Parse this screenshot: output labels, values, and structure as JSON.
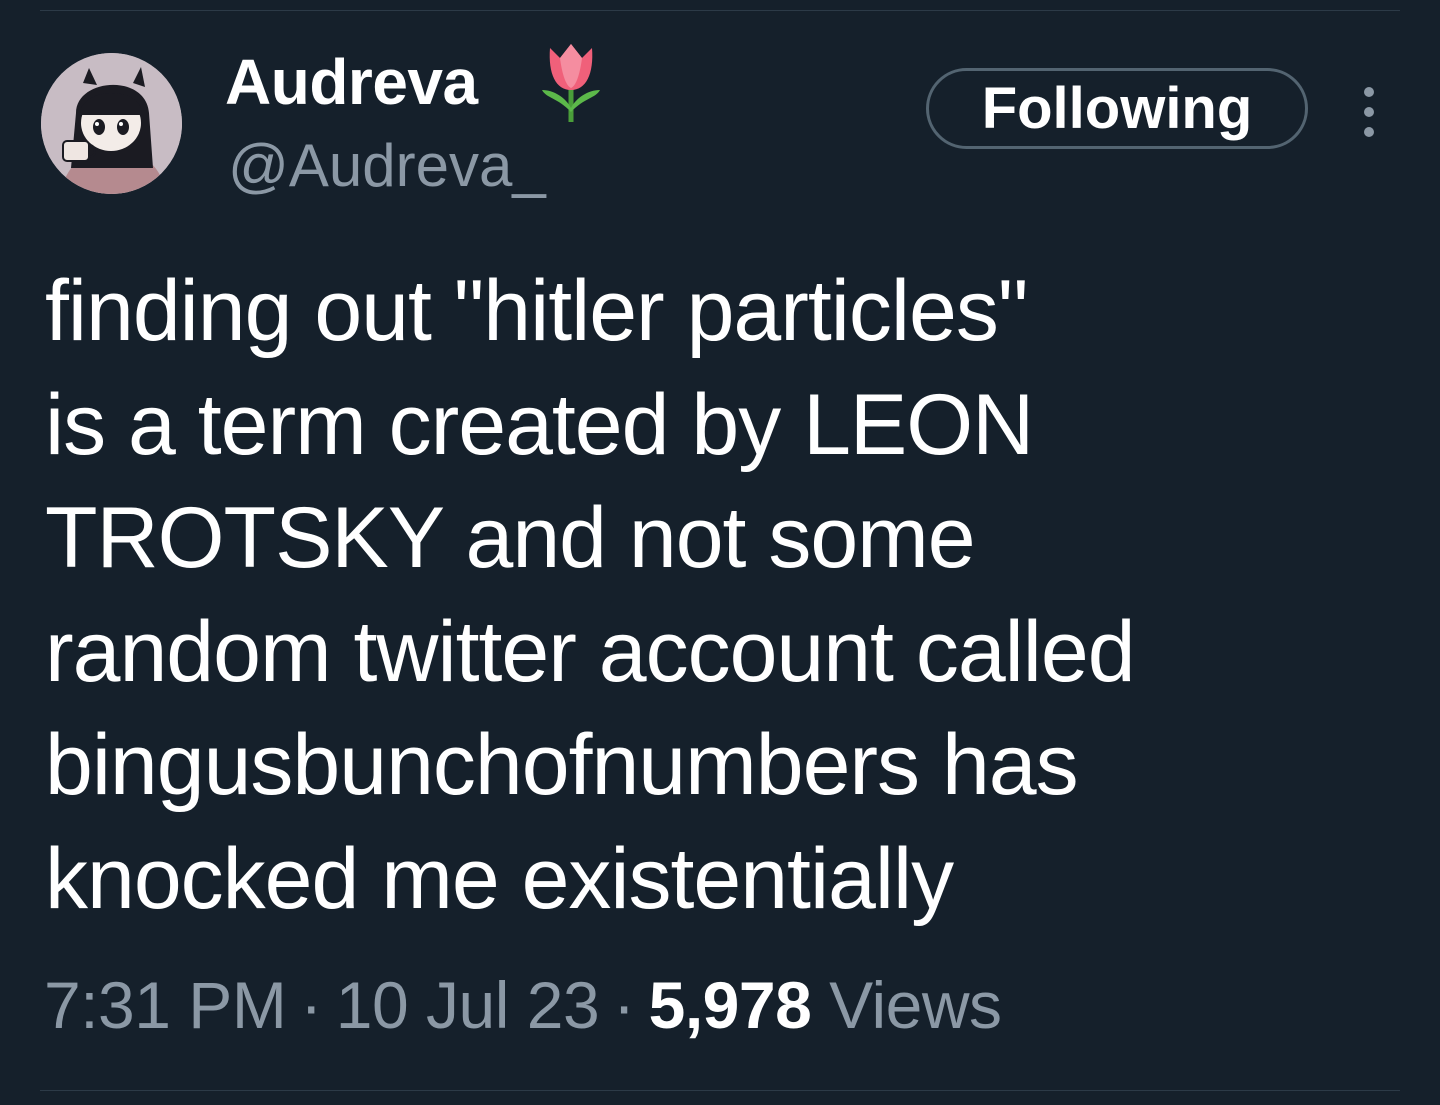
{
  "tweet": {
    "author": {
      "display_name": "Audreva",
      "display_emoji": "tulip-emoji",
      "handle": "@Audreva_",
      "avatar": "avatar-image"
    },
    "follow_button_label": "Following",
    "more_icon": "more-vertical-icon",
    "text": "finding out \"hitler particles\"\nis a term created by LEON\nTROTSKY and not some\nrandom twitter account called\nbingusbunchofnumbers has\nknocked me existentially",
    "time": "7:31 PM",
    "separator": "·",
    "date": "10 Jul 23",
    "views_count": "5,978",
    "views_label": "Views"
  },
  "colors": {
    "background": "#15202b",
    "text_primary": "#ffffff",
    "text_secondary": "#8b98a5",
    "button_border": "#536471"
  }
}
